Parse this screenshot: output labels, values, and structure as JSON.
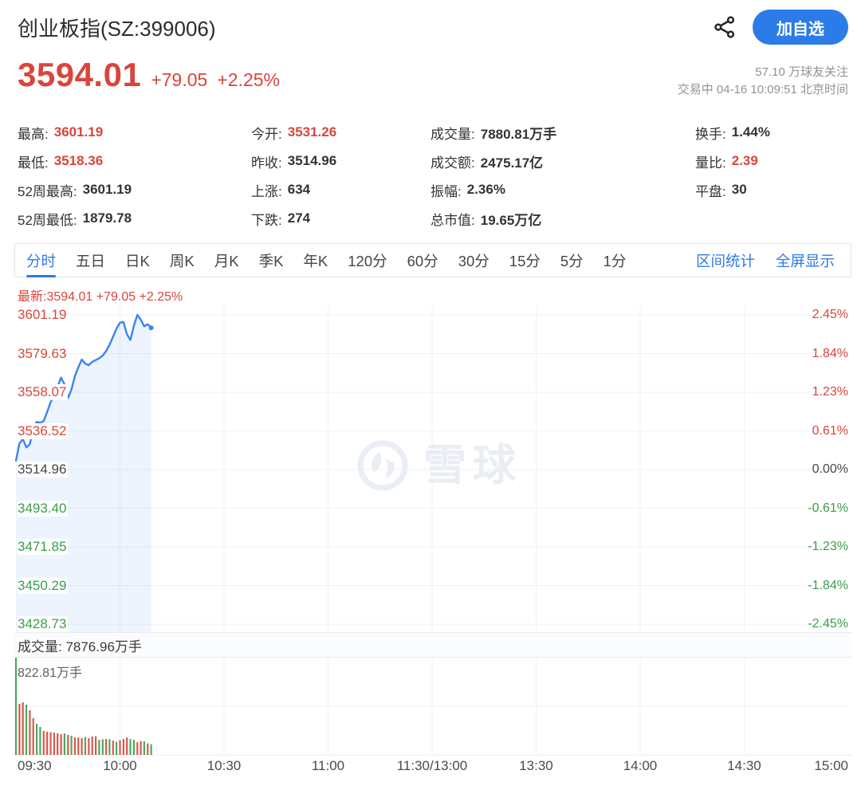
{
  "header": {
    "title": "创业板指(SZ:399006)",
    "add_button": "加自选"
  },
  "quote": {
    "price": "3594.01",
    "change": "+79.05",
    "change_pct": "+2.25%",
    "followers": "57.10 万球友关注",
    "session": "交易中 04-16 10:09:51 北京时间"
  },
  "stats": {
    "columns": [
      [
        {
          "label": "最高:",
          "value": "3601.19",
          "tone": "up"
        },
        {
          "label": "最低:",
          "value": "3518.36",
          "tone": "up"
        },
        {
          "label": "52周最高:",
          "value": "3601.19",
          "tone": "dark"
        },
        {
          "label": "52周最低:",
          "value": "1879.78",
          "tone": "dark"
        }
      ],
      [
        {
          "label": "今开:",
          "value": "3531.26",
          "tone": "up"
        },
        {
          "label": "昨收:",
          "value": "3514.96",
          "tone": "dark"
        },
        {
          "label": "上涨:",
          "value": "634",
          "tone": "dark"
        },
        {
          "label": "下跌:",
          "value": "274",
          "tone": "dark"
        }
      ],
      [
        {
          "label": "成交量:",
          "value": "7880.81万手",
          "tone": "dark"
        },
        {
          "label": "成交额:",
          "value": "2475.17亿",
          "tone": "dark"
        },
        {
          "label": "振幅:",
          "value": "2.36%",
          "tone": "dark"
        },
        {
          "label": "总市值:",
          "value": "19.65万亿",
          "tone": "dark"
        }
      ],
      [
        {
          "label": "换手:",
          "value": "1.44%",
          "tone": "dark"
        },
        {
          "label": "量比:",
          "value": "2.39",
          "tone": "up"
        },
        {
          "label": "平盘:",
          "value": "30",
          "tone": "dark"
        }
      ]
    ]
  },
  "tabs": {
    "items": [
      {
        "label": "分时",
        "active": true
      },
      {
        "label": "五日",
        "active": false
      },
      {
        "label": "日K",
        "active": false
      },
      {
        "label": "周K",
        "active": false
      },
      {
        "label": "月K",
        "active": false
      },
      {
        "label": "季K",
        "active": false
      },
      {
        "label": "年K",
        "active": false
      },
      {
        "label": "120分",
        "active": false
      },
      {
        "label": "60分",
        "active": false
      },
      {
        "label": "30分",
        "active": false
      },
      {
        "label": "15分",
        "active": false
      },
      {
        "label": "5分",
        "active": false
      },
      {
        "label": "1分",
        "active": false
      }
    ],
    "links": [
      "区间统计",
      "全屏显示"
    ]
  },
  "chart_data": {
    "type": "line",
    "latest_label": "最新:3594.01 +79.05 +2.25%",
    "watermark": "雪球",
    "prev_close": 3514.96,
    "session_high": 3601.19,
    "session_low": 3518.36,
    "axis_price_max": 3601.19,
    "axis_price_min": 3428.73,
    "y_axis_left": [
      {
        "label": "3601.19",
        "tone": "up"
      },
      {
        "label": "3579.63",
        "tone": "up"
      },
      {
        "label": "3558.07",
        "tone": "up"
      },
      {
        "label": "3536.52",
        "tone": "up"
      },
      {
        "label": "3514.96",
        "tone": "flat"
      },
      {
        "label": "3493.40",
        "tone": "down"
      },
      {
        "label": "3471.85",
        "tone": "down"
      },
      {
        "label": "3450.29",
        "tone": "down"
      },
      {
        "label": "3428.73",
        "tone": "down"
      }
    ],
    "y_axis_right": [
      {
        "label": "2.45%",
        "tone": "up"
      },
      {
        "label": "1.84%",
        "tone": "up"
      },
      {
        "label": "1.23%",
        "tone": "up"
      },
      {
        "label": "0.61%",
        "tone": "up"
      },
      {
        "label": "0.00%",
        "tone": "flat"
      },
      {
        "label": "-0.61%",
        "tone": "down"
      },
      {
        "label": "-1.23%",
        "tone": "down"
      },
      {
        "label": "-1.84%",
        "tone": "down"
      },
      {
        "label": "-2.45%",
        "tone": "down"
      }
    ],
    "x_labels": [
      "09:30",
      "10:00",
      "10:30",
      "11:00",
      "11:30/13:00",
      "13:30",
      "14:00",
      "14:30",
      "15:00"
    ],
    "minutes_total": 240,
    "prices": [
      3520.0,
      3529.5,
      3532.0,
      3527.3,
      3529.0,
      3538.5,
      3541.5,
      3541.0,
      3542.0,
      3547.0,
      3552.5,
      3556.0,
      3561.0,
      3566.2,
      3562.5,
      3554.8,
      3559.5,
      3567.0,
      3572.0,
      3576.3,
      3574.0,
      3573.2,
      3575.0,
      3576.0,
      3577.0,
      3578.5,
      3581.0,
      3584.5,
      3589.0,
      3593.5,
      3596.8,
      3597.3,
      3590.5,
      3587.2,
      3595.0,
      3601.19,
      3598.5,
      3594.8,
      3596.0,
      3594.01
    ],
    "volume": {
      "title": "成交量: 7876.96万手",
      "axis_max_label": "822.81万手",
      "axis_max": 822.81,
      "values": [
        822.81,
        432,
        445,
        425,
        378,
        310,
        263,
        236,
        202,
        196,
        192,
        189,
        182,
        175,
        182,
        169,
        162,
        148,
        148,
        142,
        152,
        142,
        155,
        159,
        128,
        132,
        135,
        132,
        121,
        111,
        125,
        135,
        148,
        135,
        128,
        108,
        118,
        115,
        98,
        91
      ],
      "colors": [
        "g",
        "r",
        "r",
        "g",
        "r",
        "r",
        "g",
        "g",
        "r",
        "r",
        "r",
        "r",
        "r",
        "r",
        "g",
        "r",
        "g",
        "r",
        "r",
        "r",
        "g",
        "r",
        "r",
        "r",
        "g",
        "g",
        "r",
        "g",
        "r",
        "g",
        "r",
        "r",
        "r",
        "g",
        "g",
        "r",
        "r",
        "g",
        "r",
        "g"
      ]
    },
    "colors": {
      "up": "#d9453b",
      "down": "#389e4c",
      "flat": "#474747",
      "line": "#3c83f0",
      "fill": "rgba(60,131,240,0.09)",
      "vol_up": "#d9584c",
      "vol_down": "#4ea763",
      "grid": "#f1f2f4",
      "divider": "#e9ebee"
    }
  }
}
